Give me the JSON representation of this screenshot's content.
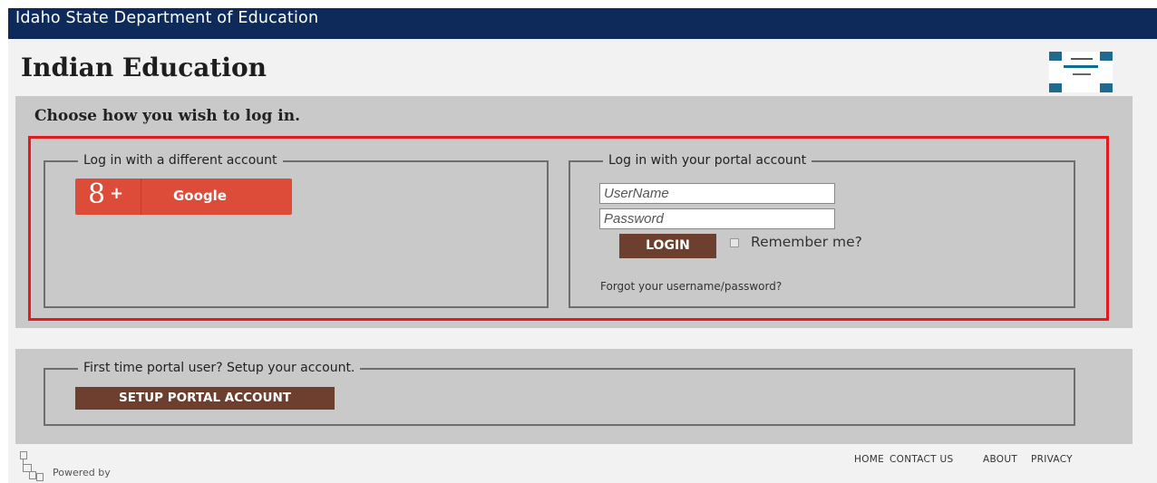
{
  "header": {
    "org_title": "Idaho State Department of Education",
    "site_title": "Indian Education"
  },
  "login": {
    "heading": "Choose how you wish to log in.",
    "external": {
      "legend": "Log in with a different account",
      "google_label": "Google",
      "google_glyph": "8",
      "google_plus": "+"
    },
    "portal": {
      "legend": "Log in with your portal account",
      "username_placeholder": "UserName",
      "username_value": "",
      "password_placeholder": "Password",
      "password_value": "",
      "login_label": "LOGIN",
      "remember_label": "Remember me?",
      "remember_checked": false,
      "forgot_label": "Forgot your username/password?"
    }
  },
  "setup": {
    "legend": "First time portal user? Setup your account.",
    "button_label": "SETUP PORTAL ACCOUNT"
  },
  "footer": {
    "powered_by": "Powered by",
    "nav": [
      "HOME",
      "CONTACT US",
      "ABOUT",
      "PRIVACY"
    ]
  },
  "icons": {
    "logo": "indian-education-logo-icon",
    "google": "google-plus-icon",
    "powered": "sitemap-icon"
  },
  "colors": {
    "topbar": "#0d2a5a",
    "panel": "#c9c9c9",
    "highlight": "#e3191f",
    "google": "#dd4b39",
    "button": "#6d3f2e"
  }
}
